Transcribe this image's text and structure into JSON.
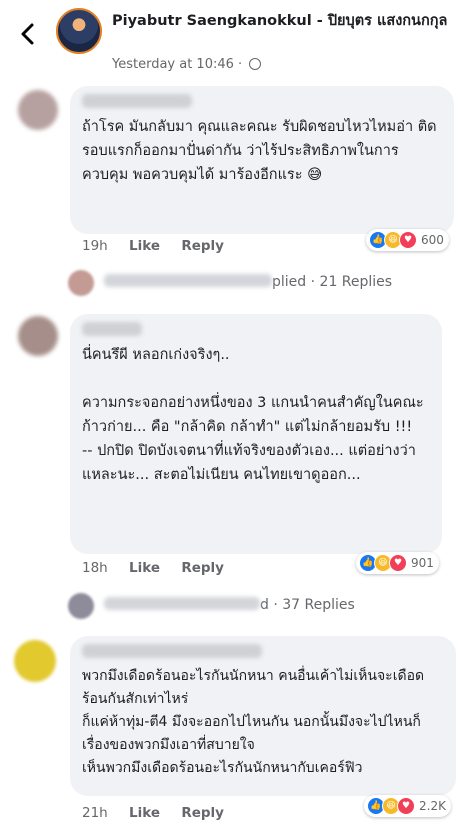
{
  "header": {
    "page_name": "Piyabutr Saengkanokkul - ปิยบุตร แสงกนกกุล",
    "timestamp": "Yesterday at 10:46",
    "separator": "·"
  },
  "comments": [
    {
      "text": "ถ้าโรค มันกลับมา คุณและคณะ รับผิดชอบไหวไหมอ่า ติดรอบแรกก็ออกมาปั่นด่ากัน ว่าไร้ประสิทธิภาพในการควบคุม พอควบคุมได้ มาร้องอีกแระ 😅",
      "time": "19h",
      "like": "Like",
      "reply": "Reply",
      "reactions": "600"
    },
    {
      "text": "นี่คนรึผี หลอกเก่งจริงๆ..\n\nความกระจอกอย่างหนึ่งของ 3 แกนนำคนสำคัญในคณะก้าวก่าย... คือ \"กล้าคิด กล้าทำ\" แต่ไม่กล้ายอมรับ !!!\n-- ปกปิด ปิดบังเจตนาที่แท้จริงของตัวเอง... แต่อย่างว่าแหละนะ... สะตอไม่เนียน คนไทยเขาดูออก...",
      "time": "18h",
      "like": "Like",
      "reply": "Reply",
      "reactions": "901"
    },
    {
      "text": "พวกมึงเดือดร้อนอะไรกันนักหนา คนอื่นเค้าไม่เห็นจะเดือดร้อนกันสักเท่าไหร่\nก็แค่ห้าทุ่ม-ตี4 มึงจะออกไปไหนกัน นอกนั้นมึงจะไปไหนก็เรื่องของพวกมึงเอาที่สบายใจ\nเห็นพวกมึงเดือดร้อนอะไรกันนักหนากับเคอร์ฟิว",
      "time": "21h",
      "like": "Like",
      "reply": "Reply",
      "reactions": "2.2K"
    }
  ],
  "reply_rows": [
    {
      "suffix": "plied",
      "count": "21 Replies"
    },
    {
      "suffix": "d",
      "count": "37 Replies"
    }
  ]
}
